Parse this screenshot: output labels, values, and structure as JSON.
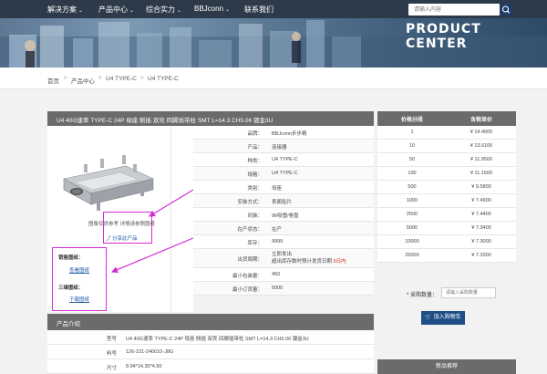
{
  "nav": {
    "items": [
      {
        "label": "解决方案",
        "chevron": "⌄"
      },
      {
        "label": "产品中心",
        "chevron": "⌄"
      },
      {
        "label": "综合实力",
        "chevron": "⌄"
      },
      {
        "label": "BBJconn",
        "chevron": "⌄"
      },
      {
        "label": "联系我们",
        "chevron": ""
      }
    ],
    "search_placeholder": "请输入内容",
    "search_icon": "search-icon"
  },
  "banner": {
    "heading": "PRODUCT CENTER"
  },
  "breadcrumb": [
    "首页",
    "产品中心",
    "U4 TYPE-C",
    "U4 TYPE-C"
  ],
  "breadcrumb_sep": ">",
  "product": {
    "title": "U4 40G速率 TYPE-C 24P 母座 侧插 双壳 四脚插带柱 SMT L=14.3 CH5.06 镀金3U",
    "image_note": "图像仅供参考 详情请参照图纸",
    "share": "分享此产品",
    "sales_drawing_label": "销售图纸：",
    "sales_drawing_link": "查看图纸",
    "model_3d_label": "三维图纸：",
    "model_3d_link": "下载图纸",
    "specs": [
      {
        "key": "品牌：",
        "val": "BBJconn步步精"
      },
      {
        "key": "产品：",
        "val": "连接器"
      },
      {
        "key": "种类：",
        "val": "U4 TYPE-C"
      },
      {
        "key": "规格：",
        "val": "U4 TYPE-C"
      },
      {
        "key": "类别：",
        "val": "母座"
      },
      {
        "key": "安装方式：",
        "val": "表面贴片"
      },
      {
        "key": "封装：",
        "val": "96吸塑/卷盘"
      },
      {
        "key": "在产状态：",
        "val": "在产"
      },
      {
        "key": "库存：",
        "val": "9999"
      },
      {
        "key": "出货周期：",
        "val": "立即发出",
        "val2_prefix": "超出库存数时预计发货日期 ",
        "val2_red": "5日内"
      },
      {
        "key": "最小包装量：",
        "val": "450"
      },
      {
        "key": "最小订货量：",
        "val": "5000"
      }
    ]
  },
  "pricing": {
    "col_qty": "价格分段",
    "col_price": "含税单价",
    "rows": [
      {
        "qty": "1",
        "price": "¥ 14.4000"
      },
      {
        "qty": "10",
        "price": "¥ 13.6100"
      },
      {
        "qty": "50",
        "price": "¥ 11.9500"
      },
      {
        "qty": "100",
        "price": "¥ 11.1600"
      },
      {
        "qty": "500",
        "price": "¥ 9.5800"
      },
      {
        "qty": "1000",
        "price": "¥ 7.4900"
      },
      {
        "qty": "2500",
        "price": "¥ 7.4400"
      },
      {
        "qty": "5000",
        "price": "¥ 7.3400"
      },
      {
        "qty": "10000",
        "price": "¥ 7.3000"
      },
      {
        "qty": "25000",
        "price": "¥ 7.2000"
      }
    ],
    "order_label": "* 采购数量：",
    "order_placeholder": "请输入采购数量",
    "cart_button": "加入购物车",
    "recommend": "新品推荐"
  },
  "intro": {
    "heading": "产品介绍",
    "rows": [
      {
        "key": "型号",
        "val": "U4 40G速率 TYPE-C 24P 母座 侧插 双壳 四脚插带柱 SMT L=14.3 CH5.06 镀金3U"
      },
      {
        "key": "料号",
        "val": "126-221-240010-J8G"
      },
      {
        "key": "尺寸",
        "val": "8.94*14.30*4.50"
      }
    ]
  },
  "colors": {
    "nav_bg": "#2d3a4a",
    "header_gray": "#6b6b6b",
    "link_blue": "#1f5aa8",
    "cart_blue": "#1f4e86",
    "annotation_magenta": "#d52bd5",
    "delivery_red": "#d9261c"
  }
}
